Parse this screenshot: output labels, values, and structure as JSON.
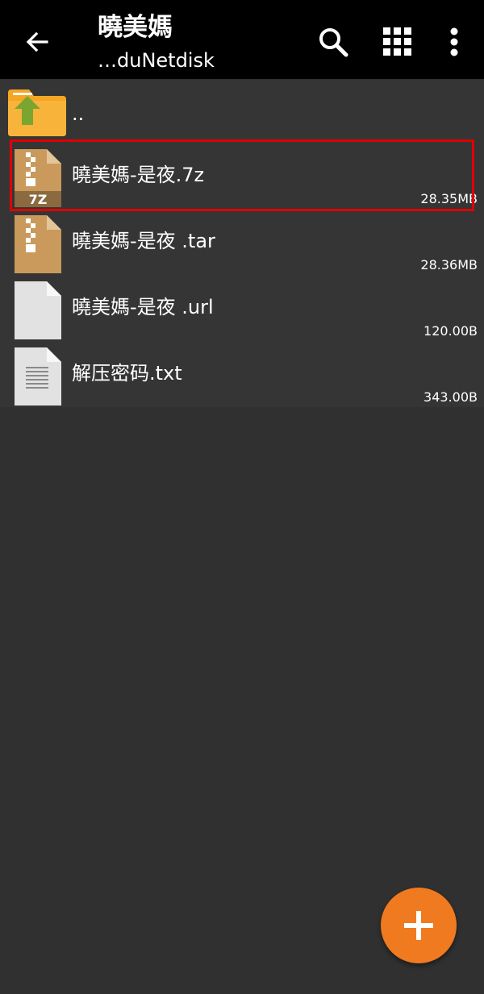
{
  "header": {
    "title": "曉美媽",
    "subtitle": "…duNetdisk",
    "back_icon": "back-arrow-icon",
    "actions": [
      "search-icon",
      "grid-view-icon",
      "more-vert-icon"
    ]
  },
  "files": [
    {
      "name": "..",
      "size": "",
      "type": "parent-folder",
      "icon": "folder-up-icon"
    },
    {
      "name": "曉美媽-是夜.7z",
      "size": "28.35MB",
      "type": "7z-archive",
      "icon": "archive-7z-icon",
      "badge": "7Z",
      "selected": true
    },
    {
      "name": "曉美媽-是夜 .tar",
      "size": "28.36MB",
      "type": "tar-archive",
      "icon": "archive-icon"
    },
    {
      "name": "曉美媽-是夜 .url",
      "size": "120.00B",
      "type": "file",
      "icon": "file-icon"
    },
    {
      "name": "解压密码.txt",
      "size": "343.00B",
      "type": "text-file",
      "icon": "text-file-icon"
    }
  ],
  "fab": {
    "icon": "plus-icon"
  },
  "colors": {
    "appbar": "#000000",
    "background": "#303030",
    "list_background": "#353535",
    "accent": "#f07a1f",
    "selection_border": "#e00000",
    "archive": "#c99a5b",
    "folder": "#f5a623",
    "folder_arrow": "#7aa531"
  }
}
